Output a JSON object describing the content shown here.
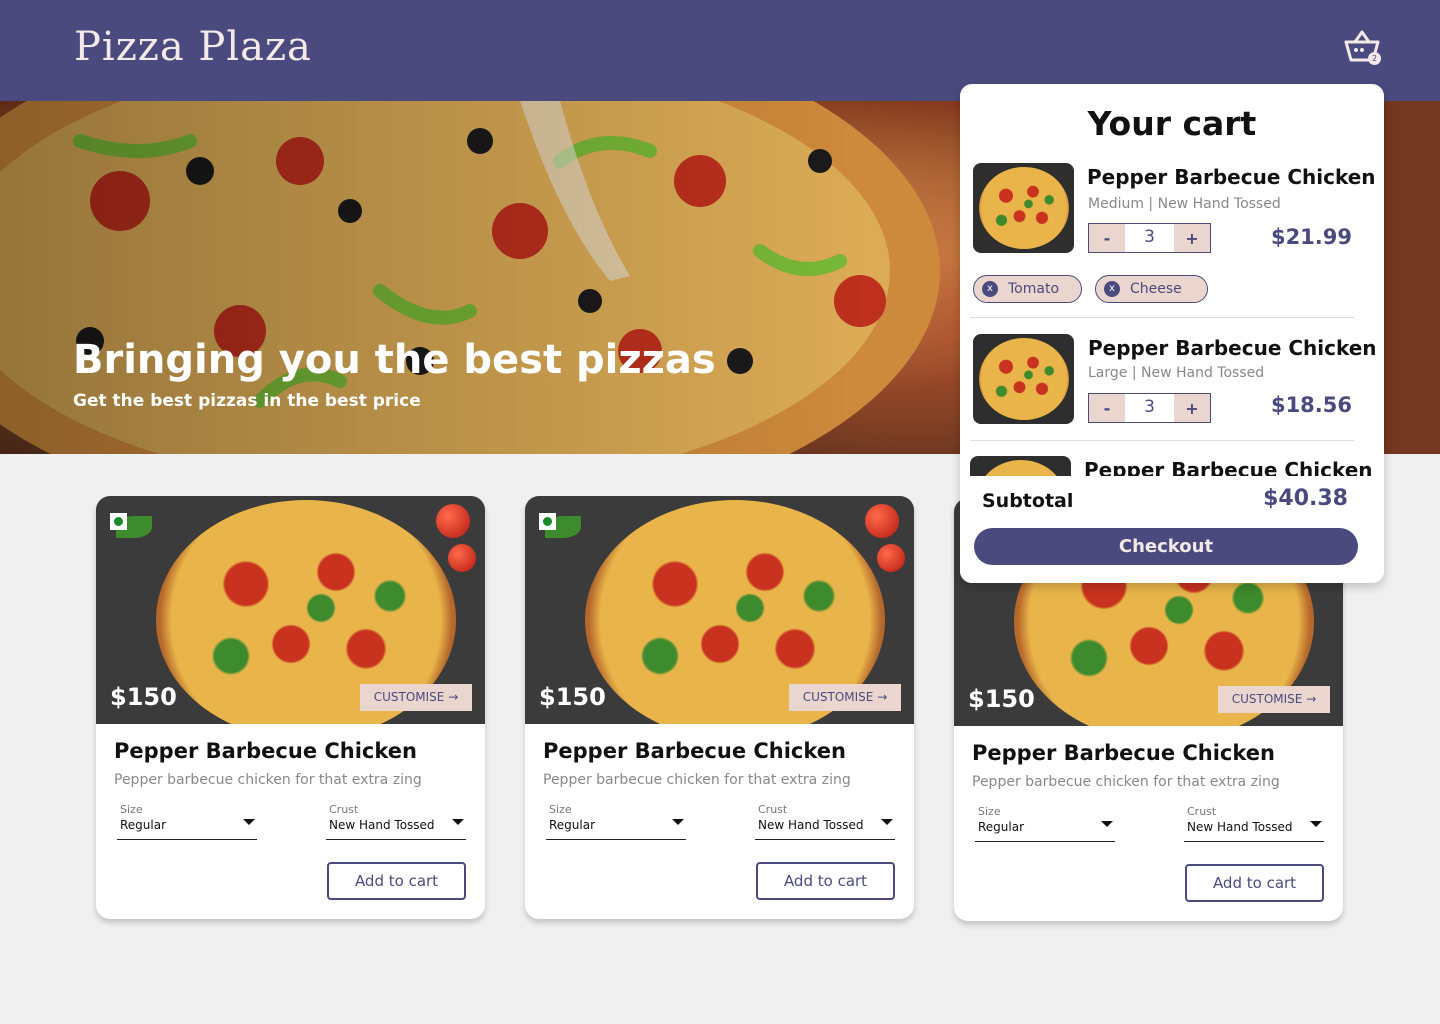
{
  "header": {
    "brand": "Pizza Plaza",
    "cart_icon": "basket-icon",
    "cart_count": "2"
  },
  "hero": {
    "title": "Bringing you the best pizzas",
    "subtitle": "Get the best pizzas in the best price"
  },
  "products": [
    {
      "price": "$150",
      "customise_label": "CUSTOMISE →",
      "title": "Pepper Barbecue Chicken",
      "description": "Pepper barbecue chicken for that extra zing",
      "size_label": "Size",
      "size_value": "Regular",
      "crust_label": "Crust",
      "crust_value": "New Hand Tossed",
      "add_label": "Add to cart"
    },
    {
      "price": "$150",
      "customise_label": "CUSTOMISE →",
      "title": "Pepper Barbecue Chicken",
      "description": "Pepper barbecue chicken for that extra zing",
      "size_label": "Size",
      "size_value": "Regular",
      "crust_label": "Crust",
      "crust_value": "New Hand Tossed",
      "add_label": "Add to cart"
    },
    {
      "price": "$150",
      "customise_label": "CUSTOMISE →",
      "title": "Pepper Barbecue Chicken",
      "description": "Pepper barbecue chicken for that extra zing",
      "size_label": "Size",
      "size_value": "Regular",
      "crust_label": "Crust",
      "crust_value": "New Hand Tossed",
      "add_label": "Add to cart"
    }
  ],
  "cart": {
    "title": "Your cart",
    "items": [
      {
        "name": "Pepper Barbecue Chicken",
        "size": "Medium",
        "crust": "New Hand Tossed",
        "meta": "Medium |  New Hand Tossed",
        "quantity": "3",
        "price": "$21.99",
        "minus": "-",
        "plus": "+",
        "toppings": [
          {
            "remove": "x",
            "label": "Tomato"
          },
          {
            "remove": "x",
            "label": "Cheese"
          }
        ]
      },
      {
        "name": "Pepper Barbecue Chicken",
        "size": "Large",
        "crust": "New Hand Tossed",
        "meta": "Large |  New Hand Tossed",
        "quantity": "3",
        "price": "$18.56",
        "minus": "-",
        "plus": "+"
      },
      {
        "name": "Pepper Barbecue Chicken"
      }
    ],
    "subtotal_label": "Subtotal",
    "subtotal_value": "$40.38",
    "checkout_label": "Checkout"
  },
  "colors": {
    "brand": "#4b4a7e",
    "accent_light": "#ead6cf",
    "brand_text": "#f3e9e9",
    "background": "#f0f0f0",
    "veg_mark": "#1a8a2a"
  }
}
